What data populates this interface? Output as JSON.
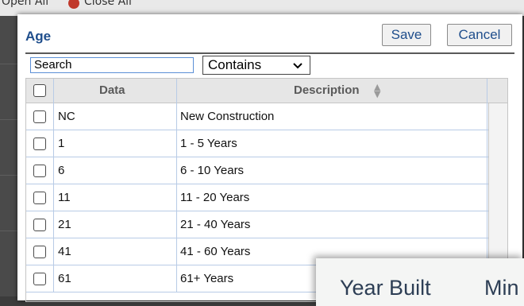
{
  "background": {
    "top_text_left": "Open All",
    "top_text_right": "Close All"
  },
  "dialog": {
    "title": "Age",
    "save_label": "Save",
    "cancel_label": "Cancel",
    "search_value": "Search",
    "filter_selected": "Contains"
  },
  "grid": {
    "columns": [
      "Data",
      "Description"
    ],
    "rows": [
      {
        "data": "NC",
        "description": "New Construction"
      },
      {
        "data": "1",
        "description": "1 - 5 Years"
      },
      {
        "data": "6",
        "description": "6 - 10 Years"
      },
      {
        "data": "11",
        "description": "11 - 20 Years"
      },
      {
        "data": "21",
        "description": "21 - 40 Years"
      },
      {
        "data": "41",
        "description": "41 - 60 Years"
      },
      {
        "data": "61",
        "description": "61+ Years"
      }
    ]
  },
  "overlay": {
    "label_year_built": "Year Built",
    "label_min": "Min"
  },
  "colors": {
    "title": "#1f4e8c",
    "row_border": "#b8cbe6",
    "header_bg": "#e6e6e6"
  }
}
